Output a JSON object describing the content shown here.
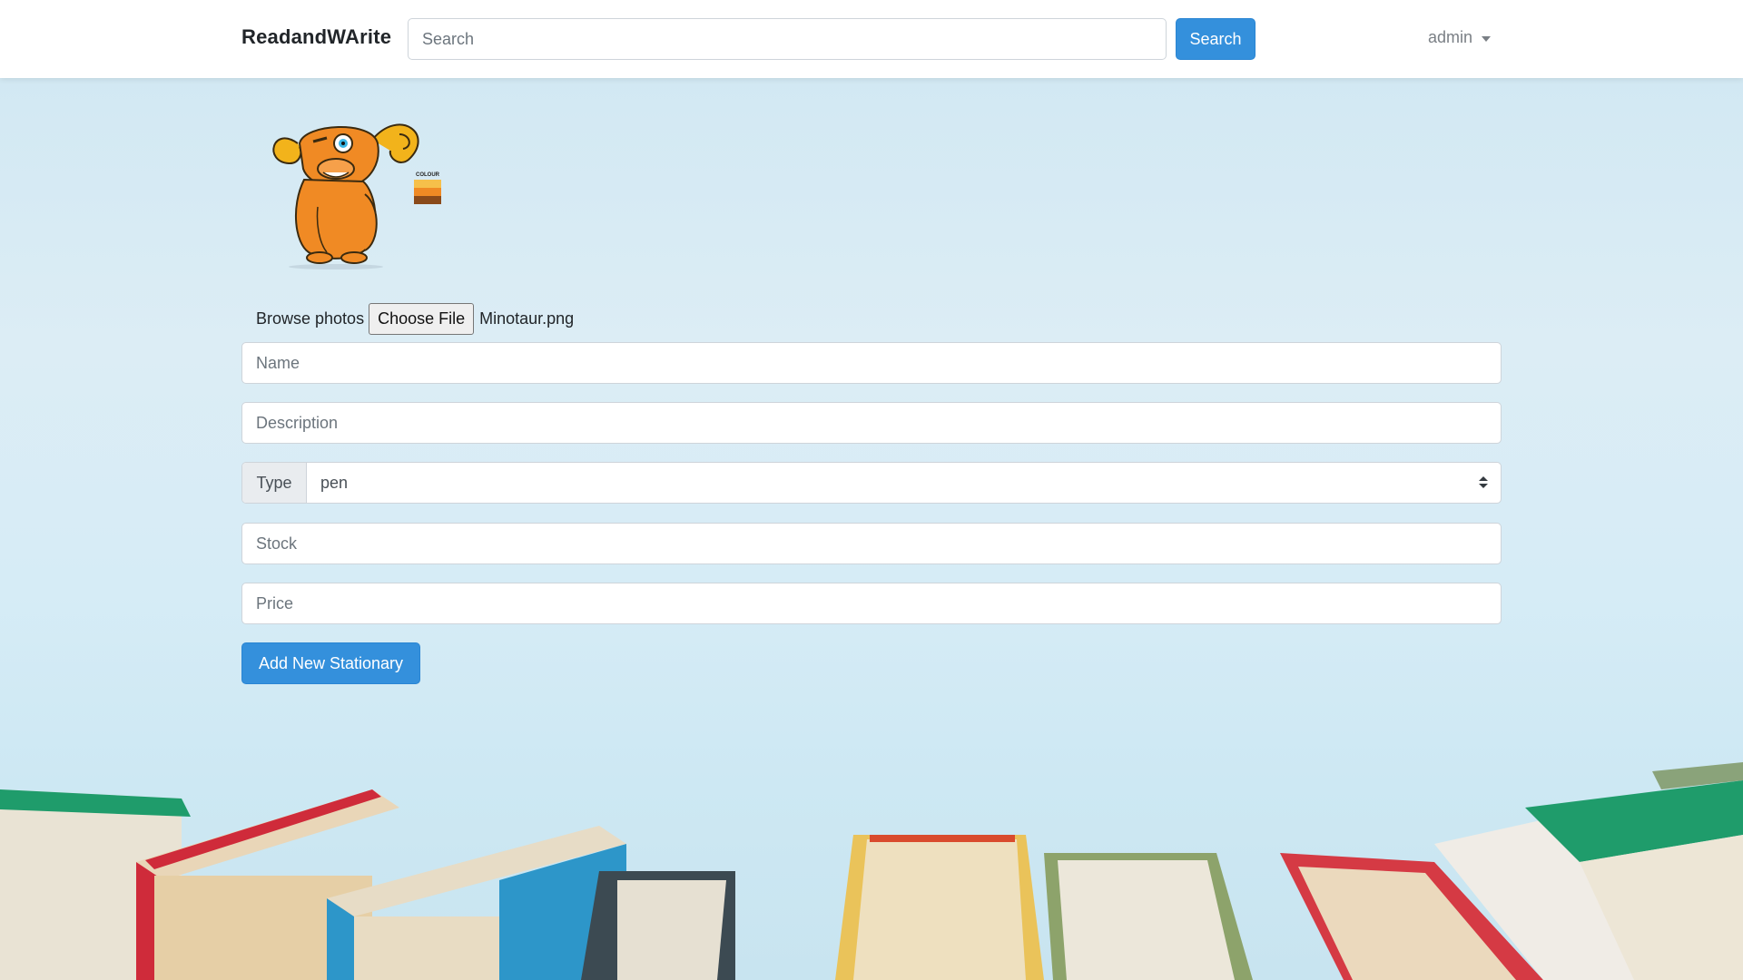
{
  "navbar": {
    "brand": "ReadandWArite",
    "search_placeholder": "Search",
    "search_button": "Search",
    "user": "admin"
  },
  "upload": {
    "label": "Browse photos",
    "button": "Choose File",
    "file_name": "Minotaur.png",
    "preview_text": "COLOUR"
  },
  "form": {
    "name_placeholder": "Name",
    "description_placeholder": "Description",
    "type_label": "Type",
    "type_value": "pen",
    "stock_placeholder": "Stock",
    "price_placeholder": "Price",
    "submit": "Add New Stationary"
  },
  "colors": {
    "primary": "#3490dc",
    "background": "#d6ecf6"
  }
}
